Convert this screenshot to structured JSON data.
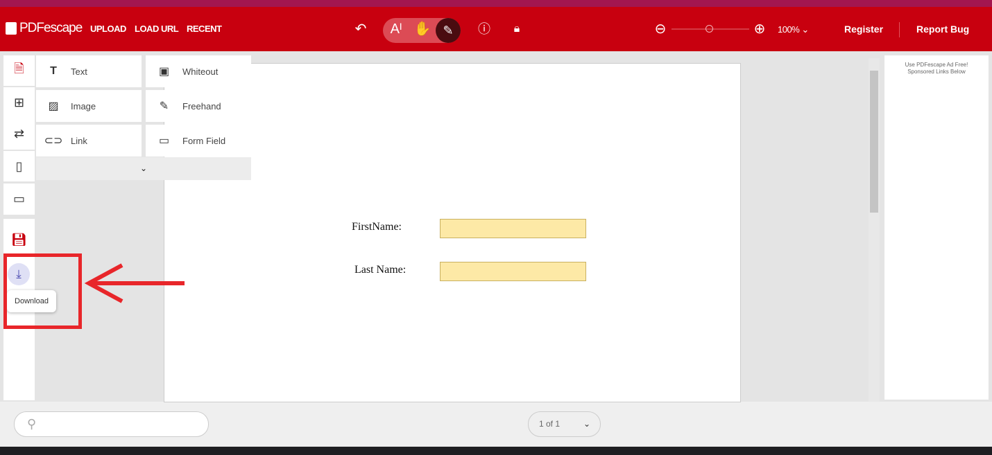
{
  "header": {
    "logo": "PDFescape",
    "nav": [
      "UPLOAD",
      "LOAD URL",
      "RECENT"
    ],
    "zoom": "100%",
    "register": "Register",
    "report_bug": "Report Bug",
    "brand_color": "#c8000f"
  },
  "tools": [
    {
      "label": "Text",
      "icon": "text-icon"
    },
    {
      "label": "Whiteout",
      "icon": "whiteout-icon"
    },
    {
      "label": "Image",
      "icon": "image-icon"
    },
    {
      "label": "Freehand",
      "icon": "pencil-icon"
    },
    {
      "label": "Link",
      "icon": "link-icon"
    },
    {
      "label": "Form Field",
      "icon": "form-field-icon"
    }
  ],
  "tooltip": "Download",
  "document": {
    "first_name_label": "FirstName:",
    "last_name_label": "Last Name:"
  },
  "ad": {
    "line1": "Use PDFescape Ad Free!",
    "line2": "Sponsored Links Below"
  },
  "footer": {
    "search_placeholder": "",
    "page_indicator": "1 of 1"
  }
}
